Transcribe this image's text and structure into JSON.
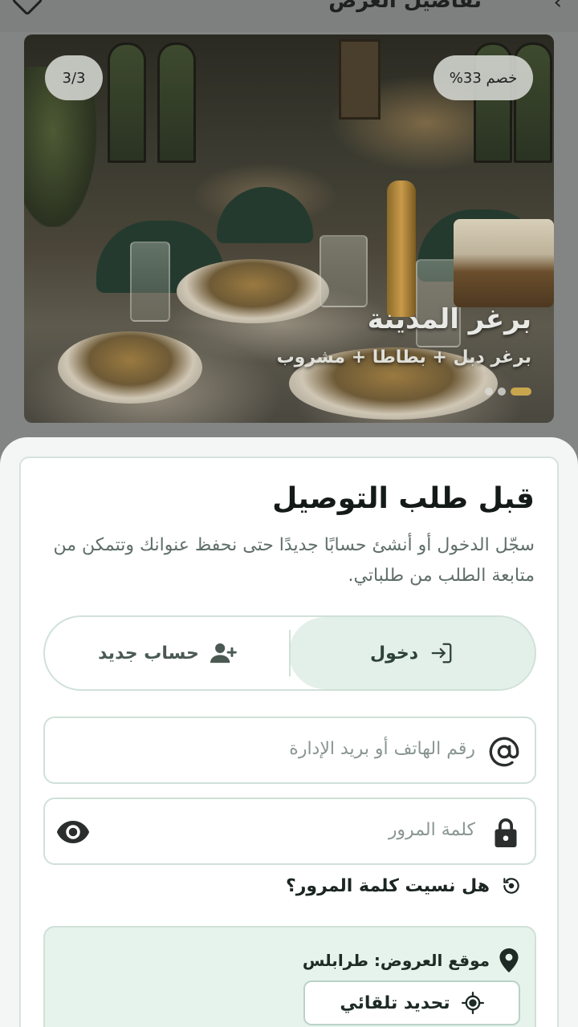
{
  "header": {
    "title": "تفاصيل العرض"
  },
  "offer": {
    "discount_badge": "خصم 33%",
    "image_counter": "3/3",
    "name": "برغر المدينة",
    "description": "برغر دبل + بطاطا + مشروب",
    "slide_count": 3,
    "active_slide": 3
  },
  "auth": {
    "title": "قبل طلب التوصيل",
    "subtitle": "سجّل الدخول أو أنشئ حسابًا جديدًا حتى نحفظ عنوانك وتتمكن من متابعة الطلب من طلباتي.",
    "tabs": {
      "login_label": "دخول",
      "signup_label": "حساب جديد"
    },
    "phone_placeholder": "رقم الهاتف أو بريد الإدارة",
    "password_placeholder": "كلمة المرور",
    "forgot_label": "هل نسيت كلمة المرور؟",
    "location_label": "موقع العروض: طرابلس",
    "auto_locate_label": "تحديد تلقائي"
  },
  "colors": {
    "accent": "#2d4238",
    "tab_active_bg": "#e3efe9",
    "border": "#cfe1d8",
    "dot_active": "#c9a64e"
  },
  "icons": {
    "login": "login-icon",
    "signup": "add-user-icon",
    "phone": "at-sign-icon",
    "password": "lock-icon",
    "visibility": "eye-icon",
    "forgot": "reset-icon",
    "location": "map-pin-icon",
    "gps": "gps-target-icon"
  }
}
